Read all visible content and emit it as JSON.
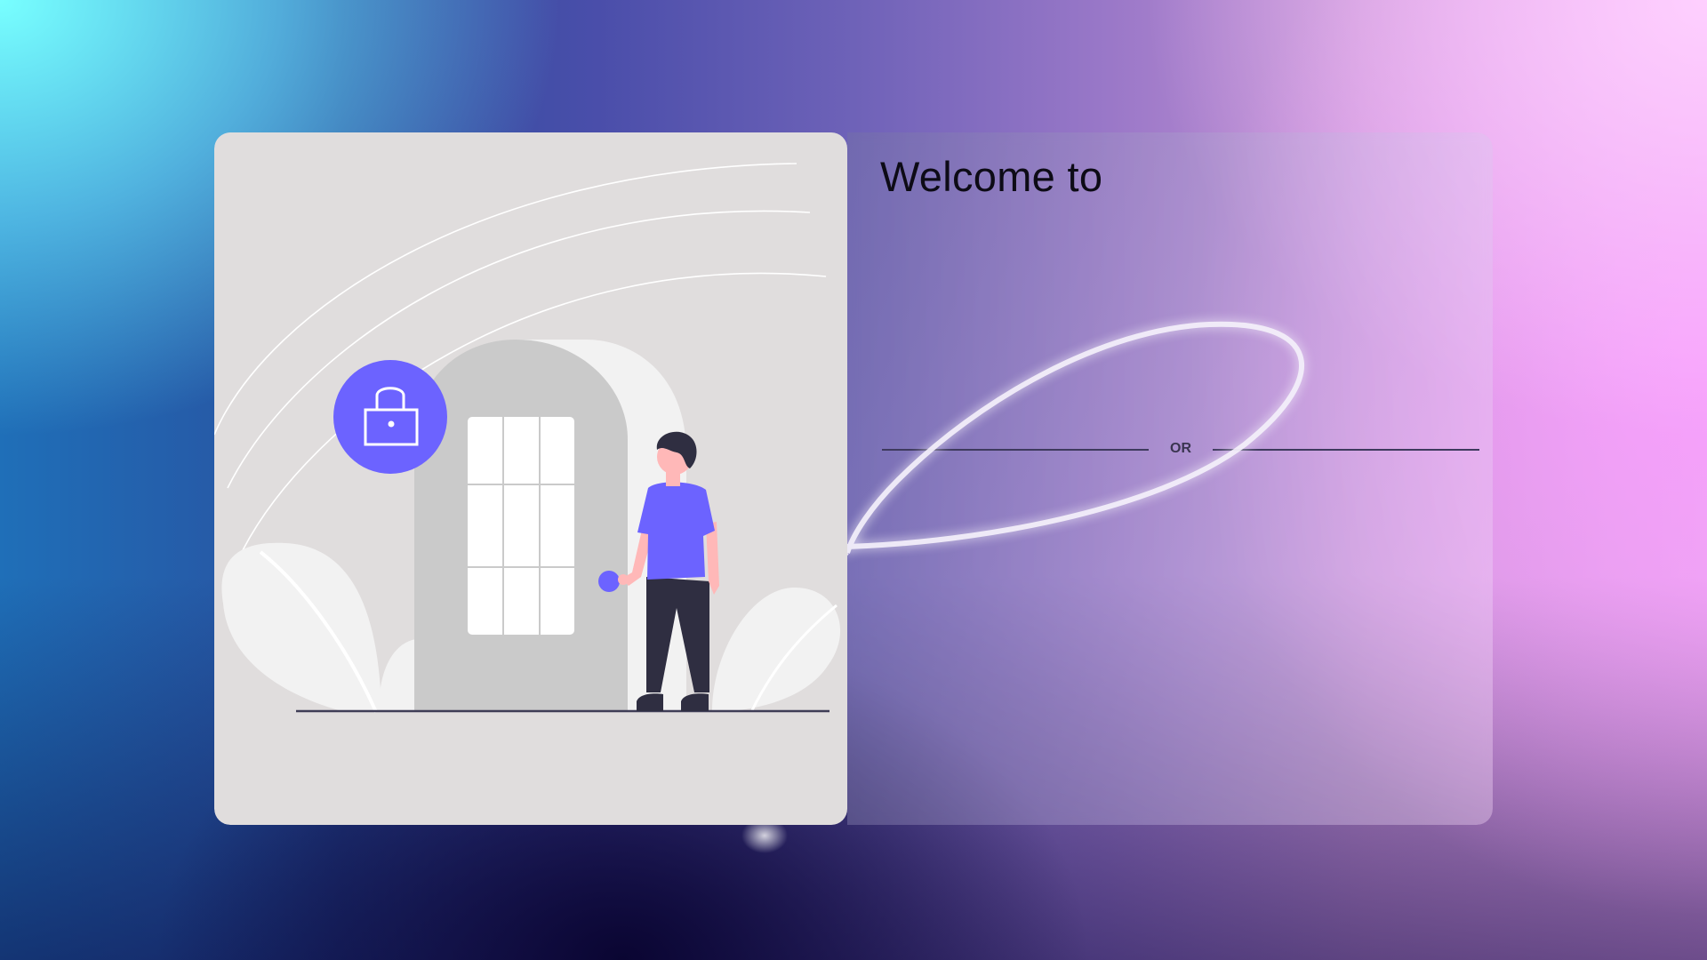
{
  "page": {
    "welcome_title": "Welcome to",
    "divider_text": "OR"
  },
  "illustration": {
    "icon": "lock-icon",
    "accent_color": "#6c63ff",
    "panel_color": "#e0dddd"
  },
  "colors": {
    "title_text": "#0d0b16",
    "divider": "#3e3a5e"
  }
}
